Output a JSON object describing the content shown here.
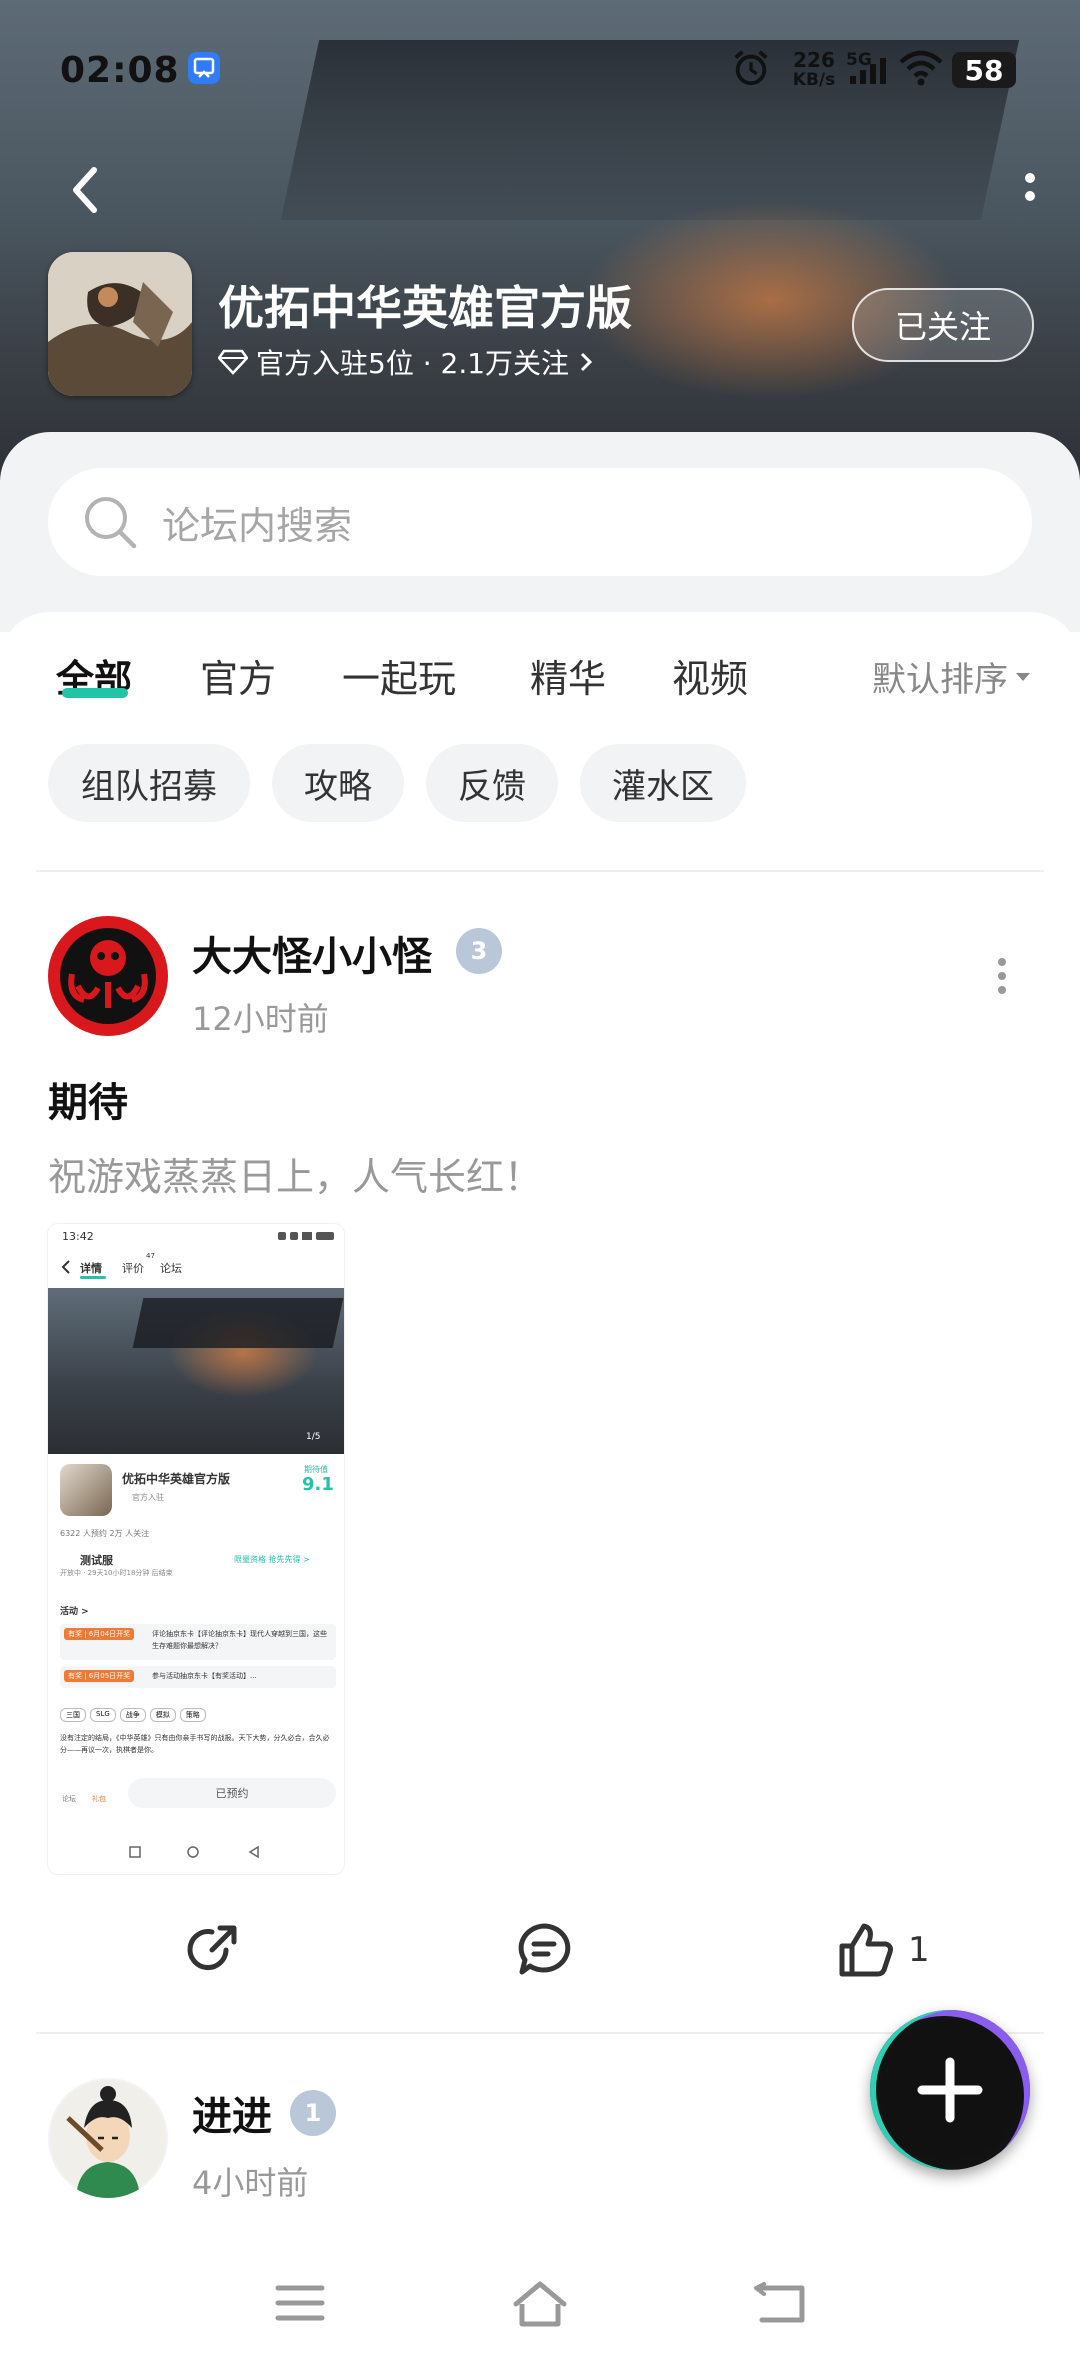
{
  "status_bar": {
    "time": "02:08",
    "net_speed_top": "226",
    "net_speed_bottom": "KB/s",
    "network": "5G",
    "battery": "58"
  },
  "header": {
    "app_name": "优拓中华英雄官方版",
    "sub_info": "官方入驻5位 · 2.1万关注",
    "follow_label": "已关注"
  },
  "search": {
    "placeholder": "论坛内搜索"
  },
  "tabs": [
    {
      "label": "全部",
      "active": true
    },
    {
      "label": "官方"
    },
    {
      "label": "一起玩"
    },
    {
      "label": "精华"
    },
    {
      "label": "视频"
    }
  ],
  "sort_label": "默认排序",
  "chips": [
    "组队招募",
    "攻略",
    "反馈",
    "灌水区"
  ],
  "posts": [
    {
      "author": "大大怪小小怪",
      "level": "3",
      "time": "12小时前",
      "title": "期待",
      "body": "祝游戏蒸蒸日上，人气长红！",
      "like_count": "1",
      "screenshot": {
        "time": "13:42",
        "tab_detail": "详情",
        "tab_review": "评价",
        "review_count": "47",
        "tab_forum": "论坛",
        "image_counter": "1/5",
        "app_name": "优拓中华英雄官方版",
        "official_tag": "官方入驻",
        "score_label": "期待值",
        "score": "9.1",
        "stats": "6322 人预约    2万 人关注",
        "test_label": "测试服",
        "test_info": "开放中 · 29天10小时18分钟 后结束",
        "test_link": "限量资格 抢先先得 >",
        "activity_label": "活动 >",
        "activity1_tag": "有奖 | 6月04日开奖",
        "activity1_text": "评论抽京东卡【评论抽京东卡】现代人穿越到三国，这些生存难题你最想解决？",
        "activity2_tag": "有奖 | 6月05日开奖",
        "activity2_text": "参与活动抽京东卡【有奖活动】...",
        "tags": [
          "三国",
          "SLG",
          "战争",
          "模拟",
          "策略"
        ],
        "desc": "没有注定的结局，《中华英雄》只有由你亲手书写的战报。天下大势，分久必合，合久必分——再议一次，执棋者是你。",
        "bottom_forum": "论坛",
        "bottom_gift": "礼包",
        "reserve_label": "已预约"
      }
    },
    {
      "author": "进进",
      "level": "1",
      "time": "4小时前"
    }
  ],
  "icons": {
    "back": "chevron-left-icon",
    "more": "more-vertical-icon",
    "search": "search-icon",
    "share": "share-icon",
    "comment": "comment-icon",
    "like": "thumbs-up-icon",
    "add": "plus-icon"
  },
  "colors": {
    "accent": "#22c3a6",
    "fab_ring_a": "#2ecfb4",
    "fab_ring_b": "#8a5cf0"
  }
}
